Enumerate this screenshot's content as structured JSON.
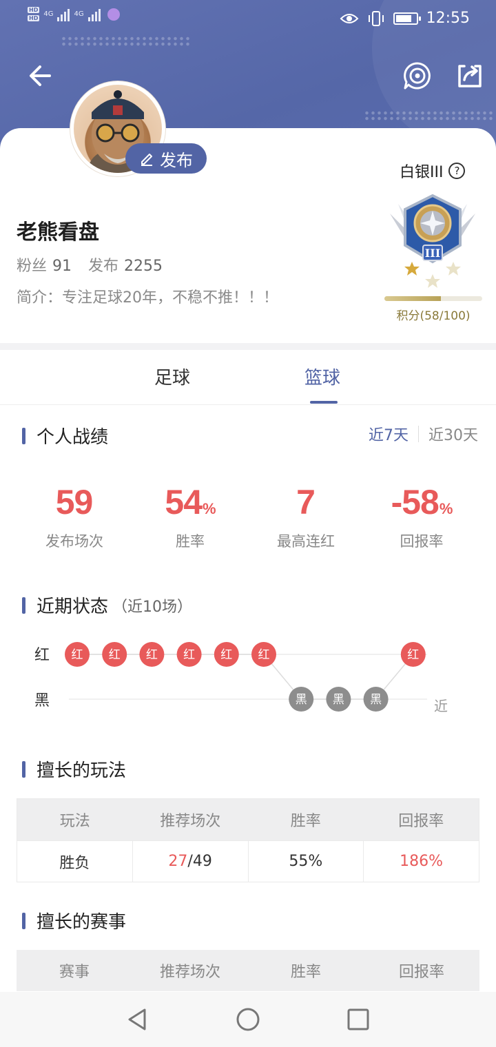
{
  "status_bar": {
    "left_labels": [
      "HD",
      "HD",
      "4G",
      "4G"
    ],
    "time": "12:55",
    "icons": [
      "eye-icon",
      "vibrate-icon",
      "battery-icon"
    ]
  },
  "header": {
    "back_icon": "arrow-left-icon",
    "icons": [
      "target-chat-icon",
      "share-icon"
    ]
  },
  "profile": {
    "publish_label": "发布",
    "name": "老熊看盘",
    "fans_label": "粉丝",
    "fans_count": "91",
    "posts_label": "发布",
    "posts_count": "2255",
    "bio": "简介：专注足球20年，不稳不推！！！",
    "rank_title": "白银III",
    "rank_help": "?",
    "score_text": "积分(58/100)",
    "score_fraction": 0.58
  },
  "tabs": [
    {
      "label": "足球",
      "active": false
    },
    {
      "label": "篮球",
      "active": true
    }
  ],
  "personal_record": {
    "title": "个人战绩",
    "range_options": [
      "近7天",
      "近30天"
    ],
    "active_range": "近7天",
    "metrics": [
      {
        "value": "59",
        "unit": "",
        "label": "发布场次"
      },
      {
        "value": "54",
        "unit": "%",
        "label": "胜率"
      },
      {
        "value": "7",
        "unit": "",
        "label": "最高连红"
      },
      {
        "value": "-58",
        "unit": "%",
        "label": "回报率"
      }
    ]
  },
  "recent_form": {
    "title": "近期状态",
    "subtitle": "（近10场）",
    "row_labels": [
      "红",
      "黑"
    ],
    "end_label": "近",
    "results": [
      "红",
      "红",
      "红",
      "红",
      "红",
      "红",
      "黑",
      "黑",
      "黑",
      "红"
    ],
    "colors": {
      "red": "#e85a5a",
      "black": "#8d8d8d"
    }
  },
  "good_at_play": {
    "title": "擅长的玩法",
    "columns": [
      "玩法",
      "推荐场次",
      "胜率",
      "回报率"
    ],
    "rows": [
      {
        "play": "胜负",
        "wins": "27",
        "total": "/49",
        "rate": "55%",
        "return": "186%"
      }
    ]
  },
  "good_at_events": {
    "title": "擅长的赛事",
    "columns": [
      "赛事",
      "推荐场次",
      "胜率",
      "回报率"
    ]
  },
  "nav_bar": {
    "icons": [
      "back-triangle-icon",
      "home-circle-icon",
      "recents-square-icon"
    ]
  },
  "colors": {
    "brand": "#5264a5",
    "accent_red": "#e85a5a",
    "gold": "#b8a257"
  }
}
